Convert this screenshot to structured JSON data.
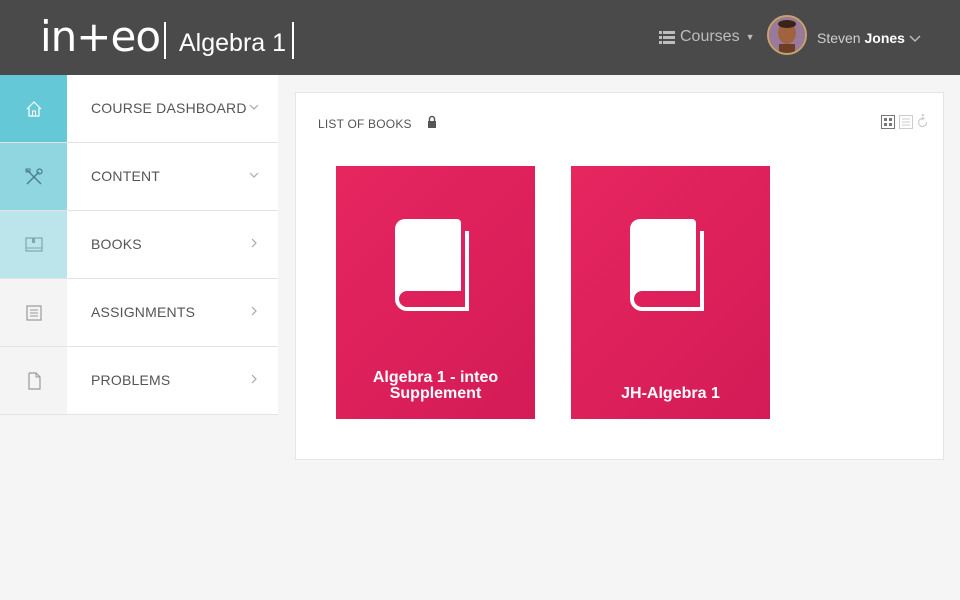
{
  "header": {
    "logo_text": "in+eo",
    "app_title": "Algebra 1",
    "courses_label": "Courses",
    "user_first": "Steven",
    "user_last": "Jones"
  },
  "sidebar": {
    "items": [
      {
        "label": "COURSE DASHBOARD",
        "icon": "home-icon",
        "chevron": "down",
        "icon_bg": "#65c8d6"
      },
      {
        "label": "CONTENT",
        "icon": "tools-icon",
        "chevron": "down",
        "icon_bg": "#8fd6e0"
      },
      {
        "label": "BOOKS",
        "icon": "book-icon",
        "chevron": "right",
        "icon_bg": "#bbe5ea"
      },
      {
        "label": "ASSIGNMENTS",
        "icon": "list-icon",
        "chevron": "right",
        "icon_bg": "#f4f4f4"
      },
      {
        "label": "PROBLEMS",
        "icon": "file-icon",
        "chevron": "right",
        "icon_bg": "#f4f4f4"
      }
    ]
  },
  "panel": {
    "title": "LIST OF BOOKS",
    "books": [
      {
        "title_line1": "Algebra 1 - inteo",
        "title_line2": "Supplement"
      },
      {
        "title_line1": "",
        "title_line2": "JH-Algebra 1"
      }
    ]
  },
  "colors": {
    "header_bg": "#4a4a4a",
    "book_card": "#e0205c",
    "accent_teal": "#65c8d6"
  }
}
